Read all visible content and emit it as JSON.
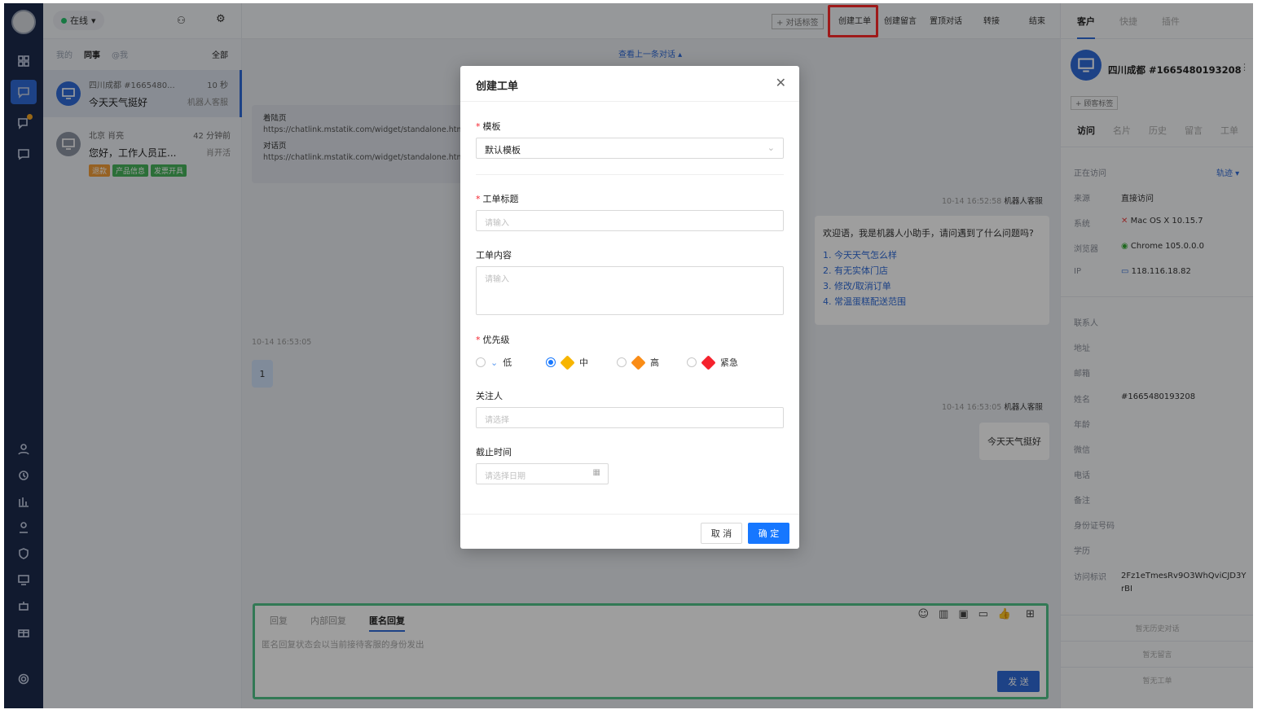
{
  "sidebar": {
    "user_status": "在线"
  },
  "conv_filters": {
    "mine": "我的",
    "colleague": "同事",
    "at_me": "@我",
    "all": "全部"
  },
  "conversations": [
    {
      "title": "四川成都 #1665480...",
      "time": "10 秒",
      "message": "今天天气挺好",
      "agent": "机器人客服"
    },
    {
      "title": "北京 肖亮",
      "time": "42 分钟前",
      "message": "您好，工作人员正...",
      "agent": "肖开活",
      "tags": [
        "退款",
        "产品信息",
        "发票开具"
      ]
    }
  ],
  "toolbar": {
    "chat_tag": "+ 对话标签",
    "create_ticket": "创建工单",
    "create_message": "创建留言",
    "pin": "置顶对话",
    "transfer": "转接",
    "end": "结束"
  },
  "chat": {
    "prev_link": "查看上一条对话 ▴",
    "landing_label": "着陆页",
    "landing_url": "https://chatlink.mstatik.com/widget/standalone.html?e",
    "dialog_label": "对话页",
    "dialog_url": "https://chatlink.mstatik.com/widget/standalone.html?e",
    "msg1_meta": "10-14 16:52:58",
    "msg1_sender": "机器人客服",
    "welcome": "欢迎语，我是机器人小助手，请问遇到了什么问题吗?",
    "options": [
      "1. 今天天气怎么样",
      "2. 有无实体门店",
      "3. 修改/取消订单",
      "4. 常温蛋糕配送范围"
    ],
    "visitor_time": "10-14 16:53:05",
    "visitor_msg": "1",
    "msg2_meta": "10-14 16:53:05",
    "msg2_sender": "机器人客服",
    "reply": "今天天气挺好"
  },
  "composer": {
    "tab_reply": "回复",
    "tab_internal": "内部回复",
    "tab_anon": "匿名回复",
    "placeholder": "匿名回复状态会以当前接待客服的身份发出",
    "send": "发 送"
  },
  "right_panel": {
    "tabs": [
      "客户",
      "快捷",
      "插件"
    ],
    "customer_name": "四川成都 #1665480193208",
    "add_tag": "+ 顾客标签",
    "subtabs": [
      "访问",
      "名片",
      "历史",
      "留言",
      "工单"
    ],
    "visiting": "正在访问",
    "track": "轨迹 ▾",
    "fields": [
      {
        "label": "来源",
        "value": "直接访问"
      },
      {
        "label": "系统",
        "value": "Mac OS X 10.15.7"
      },
      {
        "label": "浏览器",
        "value": "Chrome 105.0.0.0"
      },
      {
        "label": "IP",
        "value": "118.116.18.82"
      }
    ],
    "contact_fields": [
      "联系人",
      "地址",
      "邮箱",
      "姓名",
      "年龄",
      "微信",
      "电话",
      "备注",
      "身份证号码",
      "学历",
      "访问标识"
    ],
    "name_value": "#1665480193208",
    "visit_id": "2Fz1eTmesRv9O3WhQviCJD3YrBI",
    "no_history": "暂无历史对话",
    "no_message": "暂无留言",
    "no_ticket": "暂无工单"
  },
  "dialog": {
    "title": "创建工单",
    "template_label": "模板",
    "template_value": "默认模板",
    "ticket_title_label": "工单标题",
    "ticket_title_placeholder": "请输入",
    "content_label": "工单内容",
    "content_placeholder": "请输入",
    "priority_label": "优先级",
    "priorities": [
      "低",
      "中",
      "高",
      "紧急"
    ],
    "selected_priority": "中",
    "watcher_label": "关注人",
    "watcher_placeholder": "请选择",
    "deadline_label": "截止时间",
    "deadline_placeholder": "请选择日期",
    "cancel": "取 消",
    "confirm": "确 定"
  },
  "colors": {
    "primary": "#1677ff",
    "highlight": "#ff2a2a",
    "rail": "#1c2a4d",
    "green_border": "#52c48a"
  }
}
